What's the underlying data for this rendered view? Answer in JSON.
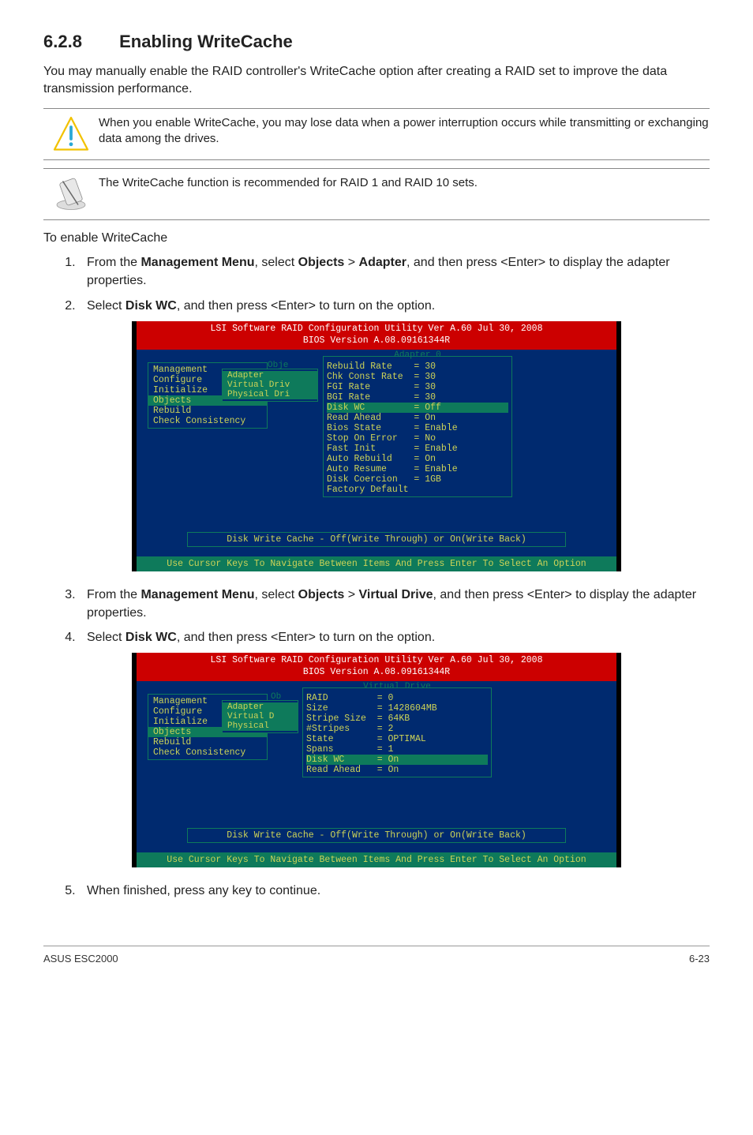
{
  "section": {
    "number": "6.2.8",
    "title": "Enabling WriteCache"
  },
  "intro": "You may manually enable the RAID controller's WriteCache option after creating a RAID set to improve the data transmission performance.",
  "callouts": {
    "warn": "When you enable WriteCache, you may lose data when a power interruption occurs while transmitting or exchanging data among the drives.",
    "note": "The WriteCache function is recommended for RAID 1 and RAID 10 sets."
  },
  "subheading": "To enable WriteCache",
  "steps": {
    "s1_a": "From the ",
    "s1_b": "Management Menu",
    "s1_c": ", select ",
    "s1_d": "Objects",
    "s1_e": " > ",
    "s1_f": "Adapter",
    "s1_g": ", and then press <Enter> to display the adapter properties.",
    "s2_a": "Select ",
    "s2_b": "Disk WC",
    "s2_c": ", and then press <Enter> to turn on the option.",
    "s3_a": "From the ",
    "s3_b": "Management Menu",
    "s3_c": ", select ",
    "s3_d": "Objects",
    "s3_e": " > ",
    "s3_f": "Virtual Drive",
    "s3_g": ", and then press <Enter> to display the adapter properties.",
    "s4_a": "Select ",
    "s4_b": "Disk WC",
    "s4_c": ", and then press <Enter> to turn on the option.",
    "s5": "When finished, press any key to continue."
  },
  "bios_common": {
    "header_line1": "LSI Software RAID Configuration Utility Ver A.60 Jul 30, 2008",
    "header_line2": "BIOS Version  A.08.09161344R",
    "footer": "Use Cursor Keys To Navigate Between Items And Press Enter To Select An Option",
    "status": "Disk Write Cache - Off(Write Through) or On(Write Back)"
  },
  "bios_menu": {
    "management": "Management",
    "configure": "Configure",
    "initialize": "Initialize",
    "objects": "Objects",
    "rebuild": "Rebuild",
    "check": "Check Consistency"
  },
  "shot1": {
    "obje_label": "Obje",
    "sub": {
      "adapter": "Adapter",
      "virtual": "Virtual Driv",
      "physical": "Physical Dri"
    },
    "box_title": "Adapter 0",
    "rows": {
      "r0": "Rebuild Rate    = 30",
      "r1": "Chk Const Rate  = 30",
      "r2": "FGI Rate        = 30",
      "r3": "BGI Rate        = 30",
      "r4": "Disk WC         = Off",
      "r5": "Read Ahead      = On",
      "r6": "Bios State      = Enable",
      "r7": "Stop On Error   = No",
      "r8": "Fast Init       = Enable",
      "r9": "Auto Rebuild    = On",
      "r10": "Auto Resume     = Enable",
      "r11": "Disk Coercion   = 1GB",
      "r12": "Factory Default"
    }
  },
  "shot2": {
    "obje_label": "Ob",
    "sub": {
      "adapter": "Adapter",
      "virtual": "Virtual D",
      "physical": "Physical"
    },
    "box_title": "Virtual Drive",
    "rows": {
      "r0": "RAID         = 0",
      "r1": "Size         = 1428604MB",
      "r2": "Stripe Size  = 64KB",
      "r3": "#Stripes     = 2",
      "r4": "State        = OPTIMAL",
      "r5": "Spans        = 1",
      "r6": "Disk WC      = On",
      "r7": "Read Ahead   = On"
    }
  },
  "footer": {
    "left": "ASUS ESC2000",
    "right": "6-23"
  }
}
